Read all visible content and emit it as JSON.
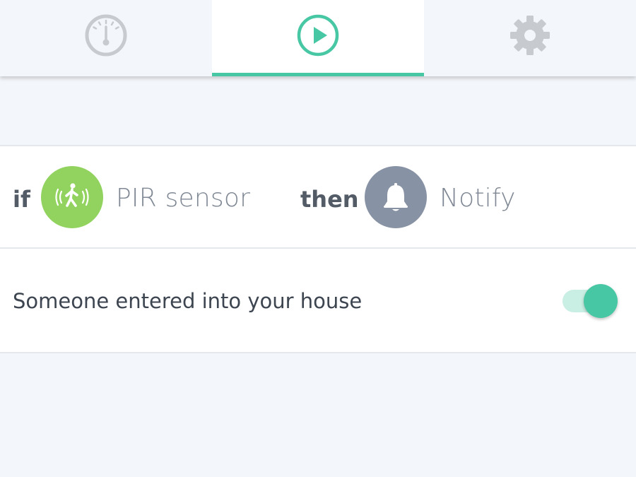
{
  "tabs": [
    {
      "name": "dashboard",
      "icon": "gauge-icon",
      "active": false
    },
    {
      "name": "rules",
      "icon": "play-icon",
      "active": true
    },
    {
      "name": "settings",
      "icon": "gear-icon",
      "active": false
    }
  ],
  "rule": {
    "if_keyword": "if",
    "trigger": {
      "label": "PIR sensor",
      "icon": "motion-sensor-icon",
      "color": "#92d35f"
    },
    "then_keyword": "then",
    "action": {
      "label": "Notify",
      "icon": "bell-icon",
      "color": "#8792a4"
    }
  },
  "notification": {
    "message": "Someone entered into your house",
    "enabled": true
  },
  "colors": {
    "accent": "#47c7a3",
    "background": "#f3f6fa",
    "inactive_icon": "#c7cbd0"
  }
}
